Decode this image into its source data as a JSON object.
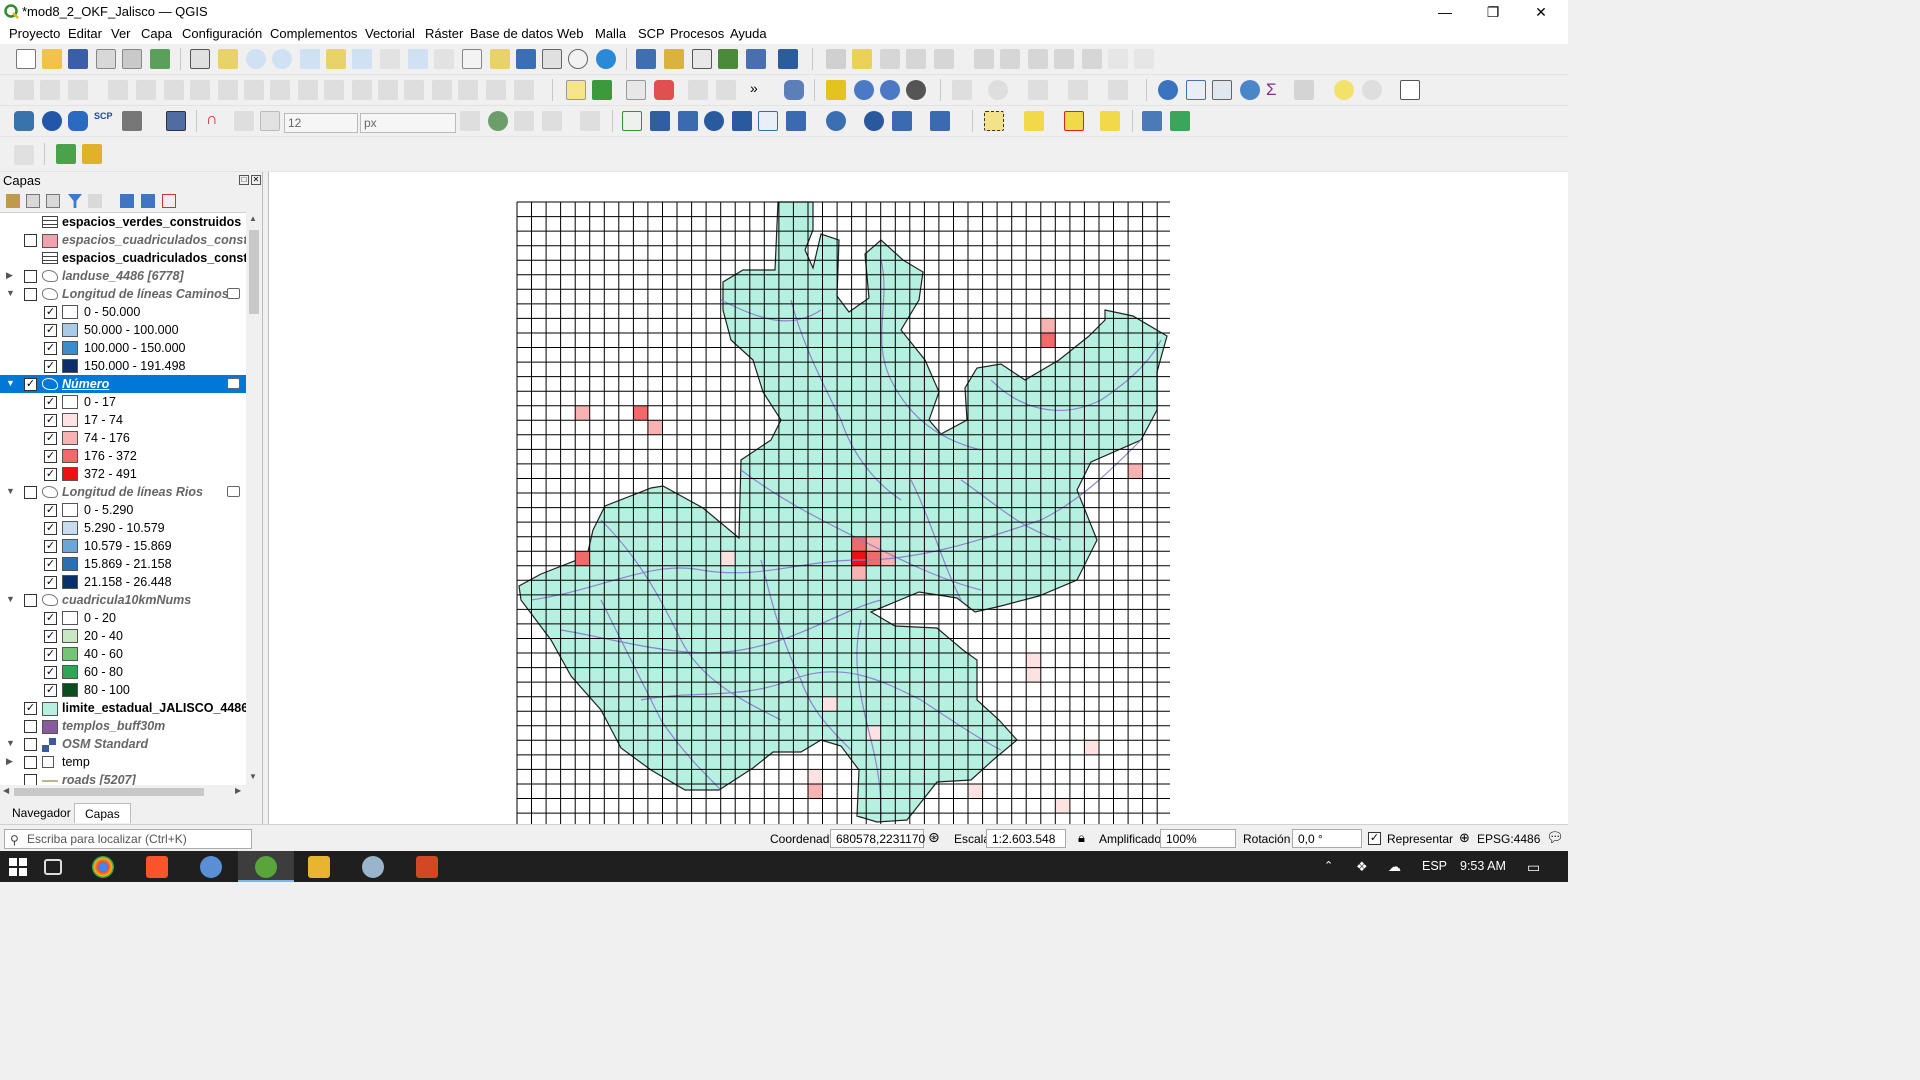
{
  "window": {
    "title": "*mod8_2_OKF_Jalisco — QGIS",
    "min_glyph": "—",
    "restore_glyph": "❐",
    "close_glyph": "✕"
  },
  "menu": [
    "Proyecto",
    "Editar",
    "Ver",
    "Capa",
    "Configuración",
    "Complementos",
    "Vectorial",
    "Ráster",
    "Base de datos",
    "Web",
    "Malla",
    "SCP",
    "Procesos",
    "Ayuda"
  ],
  "toolbar": {
    "font_size_value": "12",
    "unit_value": "px"
  },
  "layers_panel": {
    "title": "Capas",
    "items": [
      {
        "label": "espacios_verdes_construidos",
        "style": "bold",
        "icon": "table-icon",
        "checkable": false
      },
      {
        "label": "espacios_cuadriculados_constru",
        "style": "italic",
        "icon": "pink-fill",
        "checked": false
      },
      {
        "label": "espacios_cuadriculados_construidos",
        "style": "bold",
        "icon": "table-icon",
        "checkable": false
      },
      {
        "label": "landuse_4486 [6778]",
        "style": "italic",
        "icon": "polygon-icon",
        "checked": false,
        "expander": "collapsed"
      },
      {
        "label": "Longitud de líneas Caminos",
        "style": "italic",
        "icon": "polygon-icon",
        "checked": false,
        "expander": "expanded",
        "filter": true
      },
      {
        "label": "0 - 50.000",
        "legend": "#ffffff",
        "checked": true
      },
      {
        "label": "50.000 - 100.000",
        "legend": "#a9cbe6",
        "checked": true
      },
      {
        "label": "100.000 - 150.000",
        "legend": "#3d8cc8",
        "checked": true
      },
      {
        "label": "150.000 - 191.498",
        "legend": "#0a2f6b",
        "checked": true
      },
      {
        "label": "Número",
        "style": "selected",
        "icon": "polygon-icon",
        "checked": true,
        "expander": "expanded",
        "filter": true
      },
      {
        "label": "0 - 17",
        "legend": "#ffffff",
        "checked": true
      },
      {
        "label": "17 - 74",
        "legend": "#fde2e2",
        "checked": true
      },
      {
        "label": "74 - 176",
        "legend": "#f7b2b2",
        "checked": true
      },
      {
        "label": "176 - 372",
        "legend": "#f06a6a",
        "checked": true
      },
      {
        "label": "372 - 491",
        "legend": "#ee1111",
        "checked": true
      },
      {
        "label": "Longitud de líneas Rios",
        "style": "italic",
        "icon": "polygon-icon",
        "checked": false,
        "expander": "expanded",
        "filter": true
      },
      {
        "label": "0 - 5.290",
        "legend": "#ffffff",
        "checked": true
      },
      {
        "label": "5.290 - 10.579",
        "legend": "#c7dcef",
        "checked": true
      },
      {
        "label": "10.579 - 15.869",
        "legend": "#6aa6d6",
        "checked": true
      },
      {
        "label": "15.869 - 21.158",
        "legend": "#2a6fb3",
        "checked": true
      },
      {
        "label": "21.158 - 26.448",
        "legend": "#08306b",
        "checked": true
      },
      {
        "label": "cuadricula10kmNums",
        "style": "italic",
        "icon": "polygon-icon",
        "checked": false,
        "expander": "expanded"
      },
      {
        "label": "0 - 20",
        "legend": "#ffffff",
        "checked": true
      },
      {
        "label": "20 - 40",
        "legend": "#c7e8c0",
        "checked": true
      },
      {
        "label": "40 - 60",
        "legend": "#74c476",
        "checked": true
      },
      {
        "label": "60 - 80",
        "legend": "#31a354",
        "checked": true
      },
      {
        "label": "80 - 100",
        "legend": "#0b4d1f",
        "checked": true
      },
      {
        "label": "limite_estadual_JALISCO_4486",
        "style": "bold",
        "icon": "mint-fill",
        "checked": true
      },
      {
        "label": "templos_buff30m",
        "style": "italic",
        "icon": "purple-fill",
        "checked": false
      },
      {
        "label": "OSM Standard",
        "style": "italic",
        "icon": "tile-icon",
        "checked": false,
        "expander": "expanded"
      },
      {
        "label": "temp",
        "style": "normal",
        "icon": "group-icon",
        "checked": false,
        "expander": "collapsed"
      },
      {
        "label": "roads [5207]",
        "style": "italic",
        "icon": "line-icon",
        "checked": false
      }
    ],
    "tabs": [
      "Navegador",
      "Capas"
    ]
  },
  "status": {
    "locator_placeholder": "Escriba para localizar (Ctrl+K)",
    "coord_label": "Coordenada",
    "coord_value": "680578,2231170",
    "scale_label": "Escala",
    "scale_value": "1:2.603.548",
    "magnifier_label": "Amplificador",
    "magnifier_value": "100%",
    "rotation_label": "Rotación",
    "rotation_value": "0,0 °",
    "render_label": "Representar",
    "crs": "EPSG:4486"
  },
  "taskbar": {
    "lang": "ESP",
    "time": "9:53 AM"
  },
  "colors": {
    "state_fill": "#b5f0e0",
    "state_border": "#222222",
    "rivers": "#8e7fcf",
    "grid": "#000000",
    "selection": "#0078d7"
  }
}
